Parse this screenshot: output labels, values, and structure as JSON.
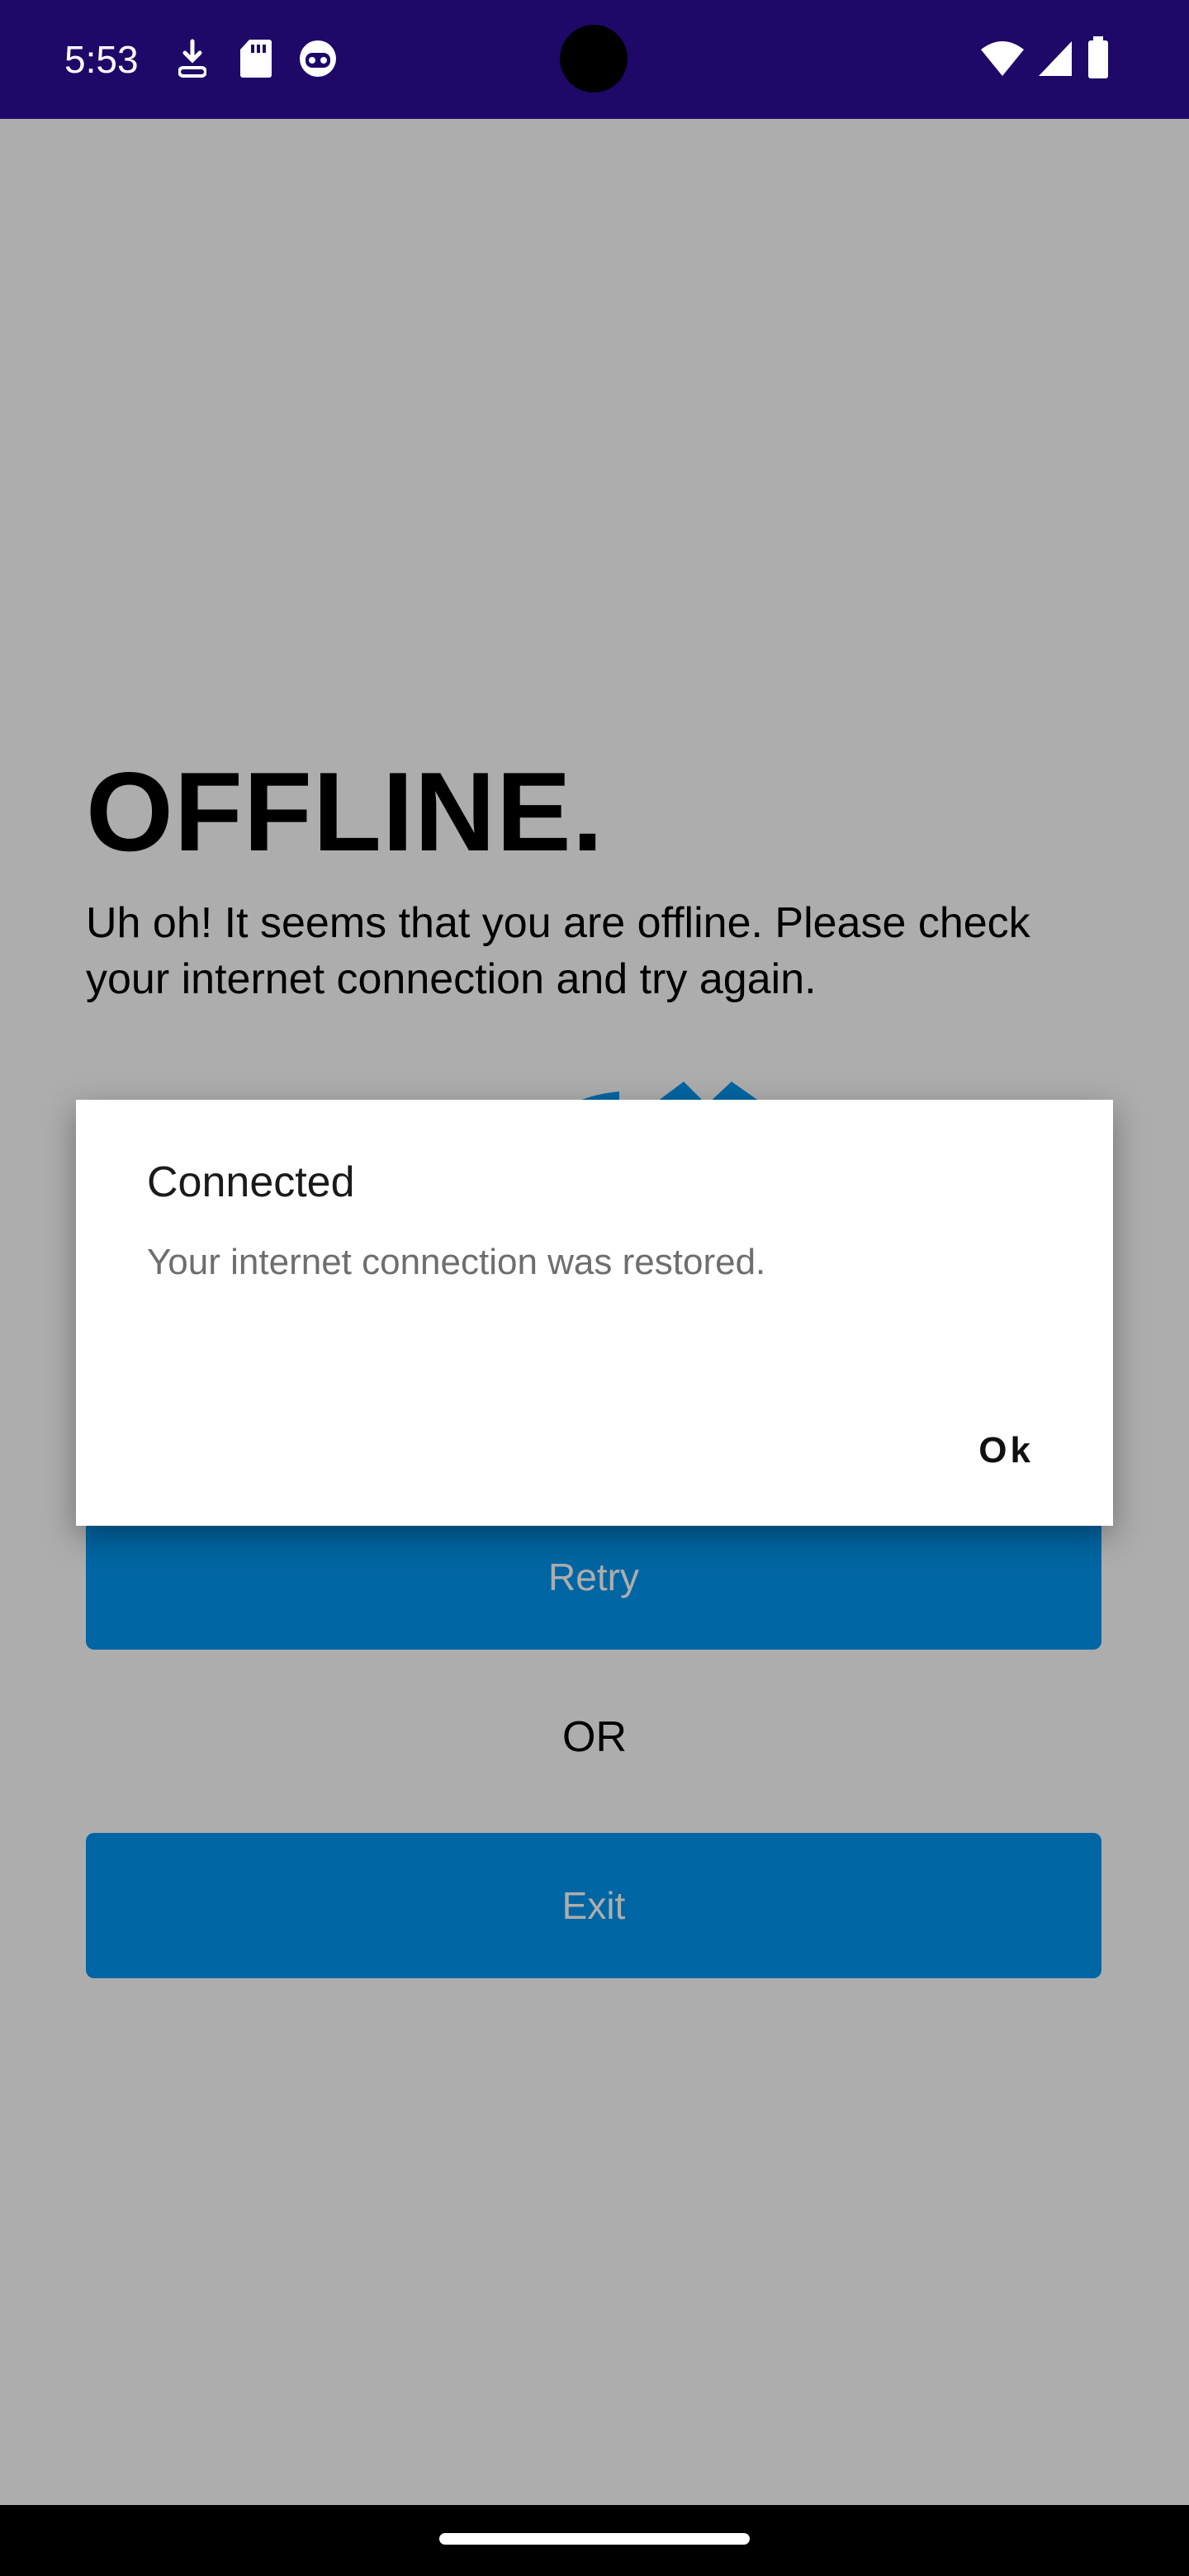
{
  "status_bar": {
    "time": "5:53",
    "left_icons": [
      "download-icon",
      "sd-card-icon",
      "robot-face-icon"
    ],
    "right_icons": [
      "wifi-icon",
      "signal-icon",
      "battery-icon"
    ]
  },
  "screen": {
    "title": "OFFLINE.",
    "message": "Uh oh! It seems that you are offline. Please check your internet connection and try again.",
    "retry_label": "Retry",
    "or_label": "OR",
    "exit_label": "Exit",
    "accent_color": "#0097f0"
  },
  "dialog": {
    "title": "Connected",
    "message": "Your internet connection was restored.",
    "ok_label": "Ok"
  }
}
